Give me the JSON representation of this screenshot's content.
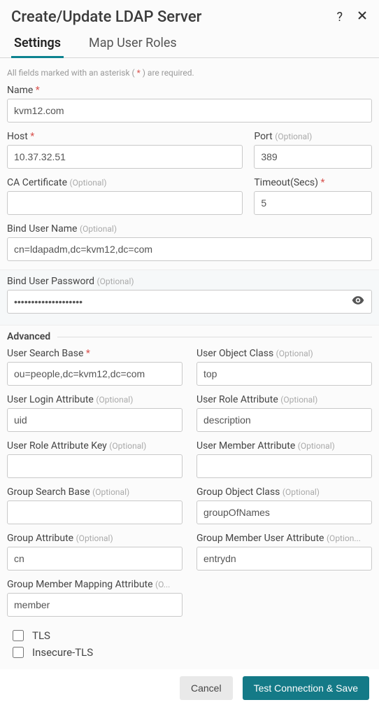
{
  "header": {
    "title": "Create/Update LDAP Server"
  },
  "tabs": {
    "settings": "Settings",
    "map_roles": "Map User Roles"
  },
  "note": {
    "prefix": "All fields marked with an asterisk ( ",
    "asterisk": "*",
    "suffix": " ) are required."
  },
  "labels": {
    "name": "Name",
    "host": "Host",
    "port": "Port",
    "ca_cert": "CA Certificate",
    "timeout": "Timeout(Secs)",
    "bind_user": "Bind User Name",
    "bind_pw": "Bind User Password",
    "advanced": "Advanced",
    "user_search_base": "User Search Base",
    "user_object_class": "User Object Class",
    "user_login_attr": "User Login Attribute",
    "user_role_attr": "User Role Attribute",
    "user_role_attr_key": "User Role Attribute Key",
    "user_member_attr": "User Member Attribute",
    "group_search_base": "Group Search Base",
    "group_object_class": "Group Object Class",
    "group_attr": "Group Attribute",
    "group_member_user_attr": "Group Member User Attribute",
    "group_member_mapping_attr": "Group Member Mapping Attribute",
    "optional_marker": "(Optional)",
    "optional_marker_trunc": "(Option...",
    "optional_marker_short": "(O...",
    "tls": "TLS",
    "insecure_tls": "Insecure-TLS"
  },
  "values": {
    "name": "kvm12.com",
    "host": "10.37.32.51",
    "port": "389",
    "ca_cert": "",
    "timeout": "5",
    "bind_user": "cn=ldapadm,dc=kvm12,dc=com",
    "bind_pw": "••••••••••••••••••••",
    "user_search_base": "ou=people,dc=kvm12,dc=com",
    "user_object_class": "top",
    "user_login_attr": "uid",
    "user_role_attr": "description",
    "user_role_attr_key": "",
    "user_member_attr": "",
    "group_search_base": "",
    "group_object_class": "groupOfNames",
    "group_attr": "cn",
    "group_member_user_attr": "entrydn",
    "group_member_mapping_attr": "member"
  },
  "buttons": {
    "cancel": "Cancel",
    "save": "Test Connection & Save"
  }
}
